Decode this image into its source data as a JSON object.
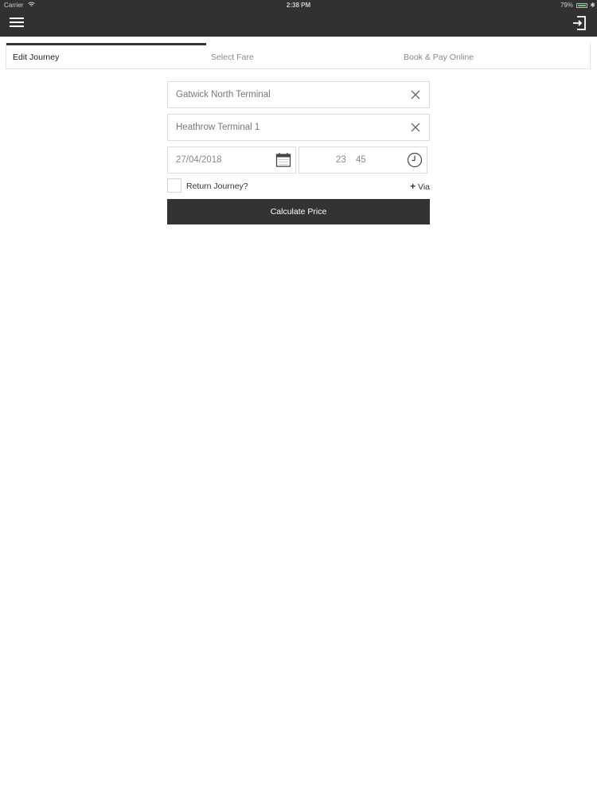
{
  "status_bar": {
    "carrier": "Carrier",
    "time": "2:38 PM",
    "battery": "79%"
  },
  "header": {
    "menu_icon": "hamburger-icon",
    "exit_icon": "sign-out-icon"
  },
  "steps": {
    "items": [
      {
        "label": "Edit Journey",
        "active": true
      },
      {
        "label": "Select Fare",
        "active": false
      },
      {
        "label": "Book & Pay Online",
        "active": false
      }
    ]
  },
  "journey": {
    "pickup": "Gatwick North Terminal",
    "dropoff": "Heathrow Terminal 1",
    "date": "27/04/2018",
    "hour": "23",
    "minute": "45",
    "return_label": "Return Journey?",
    "return_checked": false,
    "via_plus": "+",
    "via_label": "Via",
    "calculate_label": "Calculate Price"
  },
  "colors": {
    "header_bg": "#313131",
    "button_bg": "#333333",
    "battery": "#4cd964"
  }
}
